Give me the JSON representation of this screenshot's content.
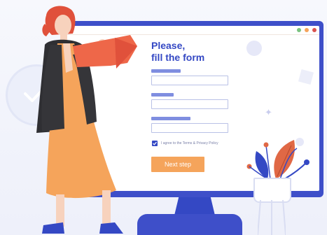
{
  "form": {
    "title_line1": "Please,",
    "title_line2": "fill the form",
    "agree_text": "I agree to the Terms & Privacy Policy",
    "next_button": "Next step"
  },
  "window_dots": [
    "#7ac27f",
    "#f5a45b",
    "#d9534f"
  ],
  "colors": {
    "accent": "#3e4fc9",
    "button": "#f5a45b",
    "monitor": "#3e4fc9"
  }
}
